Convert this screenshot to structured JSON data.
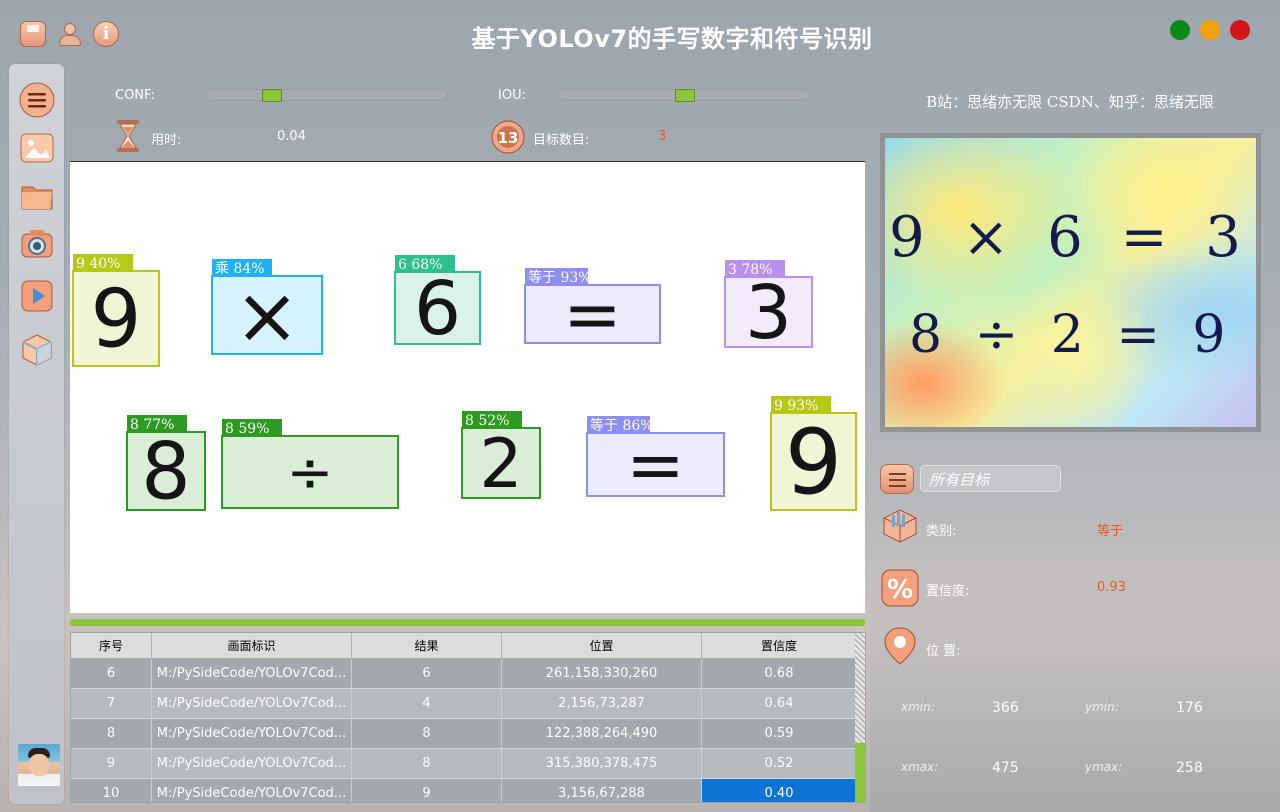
{
  "window": {
    "title": "基于YOLOv7的手写数字和符号识别",
    "icons": [
      "save-icon",
      "user-icon",
      "info-icon"
    ],
    "controls": {
      "minimize_color": "#0a8a16",
      "maximize_color": "#f2a20a",
      "close_color": "#d7141a"
    }
  },
  "sidebar": {
    "items": [
      {
        "name": "menu-icon"
      },
      {
        "name": "image-icon"
      },
      {
        "name": "folder-icon"
      },
      {
        "name": "camera-icon"
      },
      {
        "name": "video-icon"
      },
      {
        "name": "model-icon"
      }
    ],
    "avatar": "avatar"
  },
  "controls": {
    "conf_label": "CONF:",
    "conf_value": 0.25,
    "iou_label": "IOU:",
    "iou_value": 0.5,
    "time_label": "用时:",
    "time_value": "0.04",
    "count_label": "目标数目:",
    "count_value": "3",
    "accent_color": "#8cc63f"
  },
  "detections": [
    {
      "label": "9  40%",
      "digit": "9",
      "color": "#b7c818"
    },
    {
      "label": "乘  84%",
      "digit": "×",
      "color": "#1fb2f2"
    },
    {
      "label": "6  68%",
      "digit": "6",
      "color": "#2fbf8c"
    },
    {
      "label": "等于  93%",
      "digit": "=",
      "color": "#8e8ef0"
    },
    {
      "label": "3  78%",
      "digit": "3",
      "color": "#b891ec"
    },
    {
      "label": "8  77%",
      "digit": "8",
      "color": "#2d9a22"
    },
    {
      "label": "8  59%",
      "digit": "÷",
      "color": "#2d9a22"
    },
    {
      "label": "8  52%",
      "digit": "2",
      "color": "#2d9a22"
    },
    {
      "label": "等于  86%",
      "digit": "=",
      "color": "#8e8ef0"
    },
    {
      "label": "9  93%",
      "digit": "9",
      "color": "#b7c818"
    }
  ],
  "progress": {
    "value": 1.0
  },
  "table": {
    "headers": [
      "序号",
      "画面标识",
      "结果",
      "位置",
      "置信度"
    ],
    "rows": [
      [
        "6",
        "M:/PySideCode/YOLOv7Cod...",
        "6",
        "261,158,330,260",
        "0.68"
      ],
      [
        "7",
        "M:/PySideCode/YOLOv7Cod...",
        "4",
        "2,156,73,287",
        "0.64"
      ],
      [
        "8",
        "M:/PySideCode/YOLOv7Cod...",
        "8",
        "122,388,264,490",
        "0.59"
      ],
      [
        "9",
        "M:/PySideCode/YOLOv7Cod...",
        "8",
        "315,380,378,475",
        "0.52"
      ],
      [
        "10",
        "M:/PySideCode/YOLOv7Cod...",
        "9",
        "3,156,67,288",
        "0.40"
      ]
    ],
    "selected_row": 4
  },
  "right": {
    "credit": "B站：思绪亦无限  CSDN、知乎：思绪无限",
    "heatmap_rows": [
      "9 × 6 = 3",
      "8 ÷ 2 = 9"
    ],
    "filter_placeholder": "所有目标",
    "category_label": "类别:",
    "category_value": "等于",
    "confidence_label": "置信度:",
    "confidence_value": "0.93",
    "position_label": "位 置:",
    "xmin_label": "xmin:",
    "xmin_value": "366",
    "ymin_label": "ymin:",
    "ymin_value": "176",
    "xmax_label": "xmax:",
    "xmax_value": "475",
    "ymax_label": "ymax:",
    "ymax_value": "258",
    "value_color": "#e85a1e"
  }
}
